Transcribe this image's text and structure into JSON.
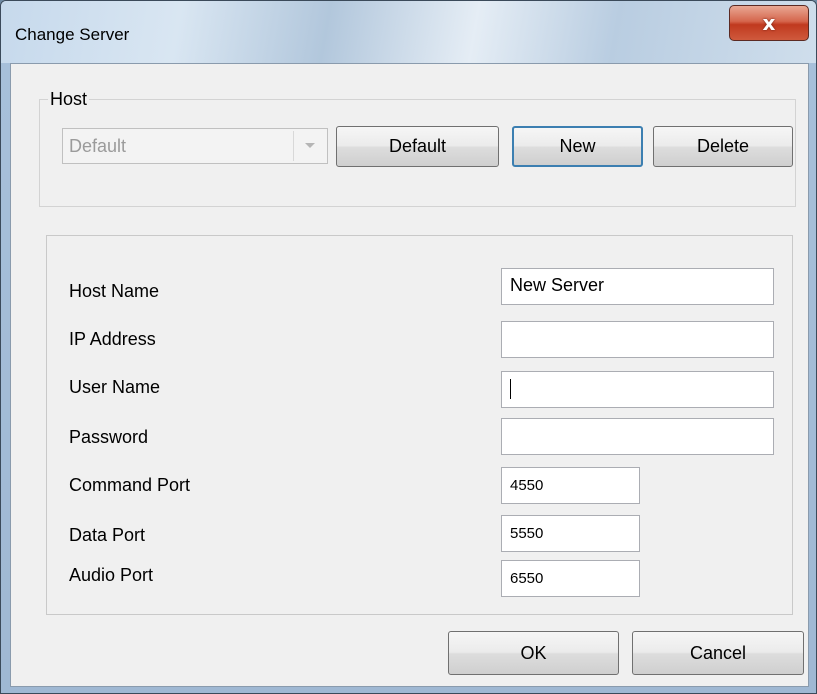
{
  "window": {
    "title": "Change Server",
    "close_symbol": "x"
  },
  "host_group": {
    "legend": "Host",
    "combo_value": "Default",
    "combo_arrow_icon": "chevron-down-icon",
    "buttons": {
      "default": "Default",
      "new": "New",
      "delete": "Delete"
    }
  },
  "fields": {
    "host_name": {
      "label": "Host Name",
      "value": "New Server"
    },
    "ip_address": {
      "label": "IP Address",
      "value": ""
    },
    "user_name": {
      "label": "User Name",
      "value": ""
    },
    "password": {
      "label": "Password",
      "value": ""
    },
    "command_port": {
      "label": "Command Port",
      "value": "4550"
    },
    "data_port": {
      "label": "Data Port",
      "value": "5550"
    },
    "audio_port": {
      "label": "Audio Port",
      "value": "6550"
    }
  },
  "footer": {
    "ok": "OK",
    "cancel": "Cancel"
  }
}
